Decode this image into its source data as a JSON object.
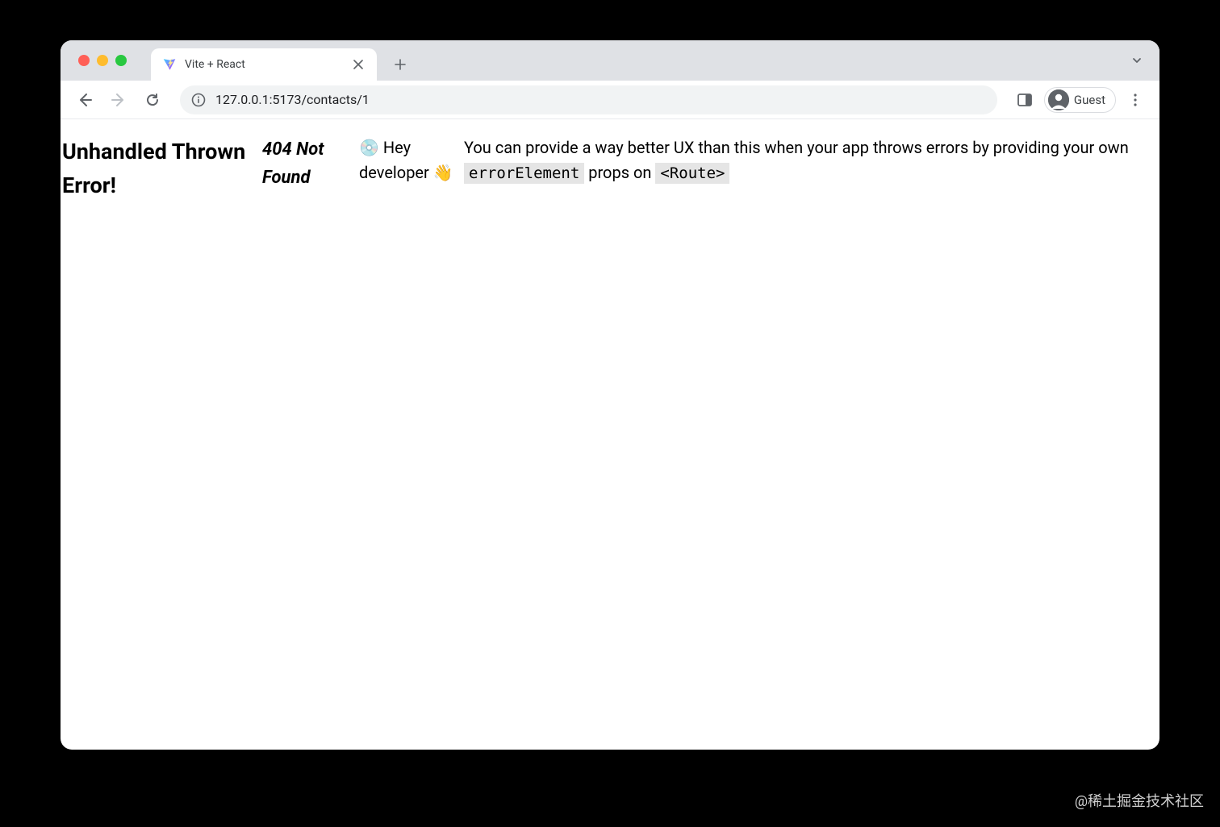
{
  "browser": {
    "tab_title": "Vite + React",
    "url": "127.0.0.1:5173/contacts/1",
    "profile_label": "Guest"
  },
  "page": {
    "error_heading": "Unhandled Thrown Error!",
    "error_status": "404 Not Found",
    "dev_greeting_prefix": "💿 Hey developer ",
    "wave_emoji": "👋",
    "fix_msg_prefix": "You can provide a way better UX than this when your app throws errors by providing your own ",
    "code_errorElement": "errorElement",
    "fix_msg_mid": " props on ",
    "code_route": "<Route>"
  },
  "watermark": "@稀土掘金技术社区"
}
